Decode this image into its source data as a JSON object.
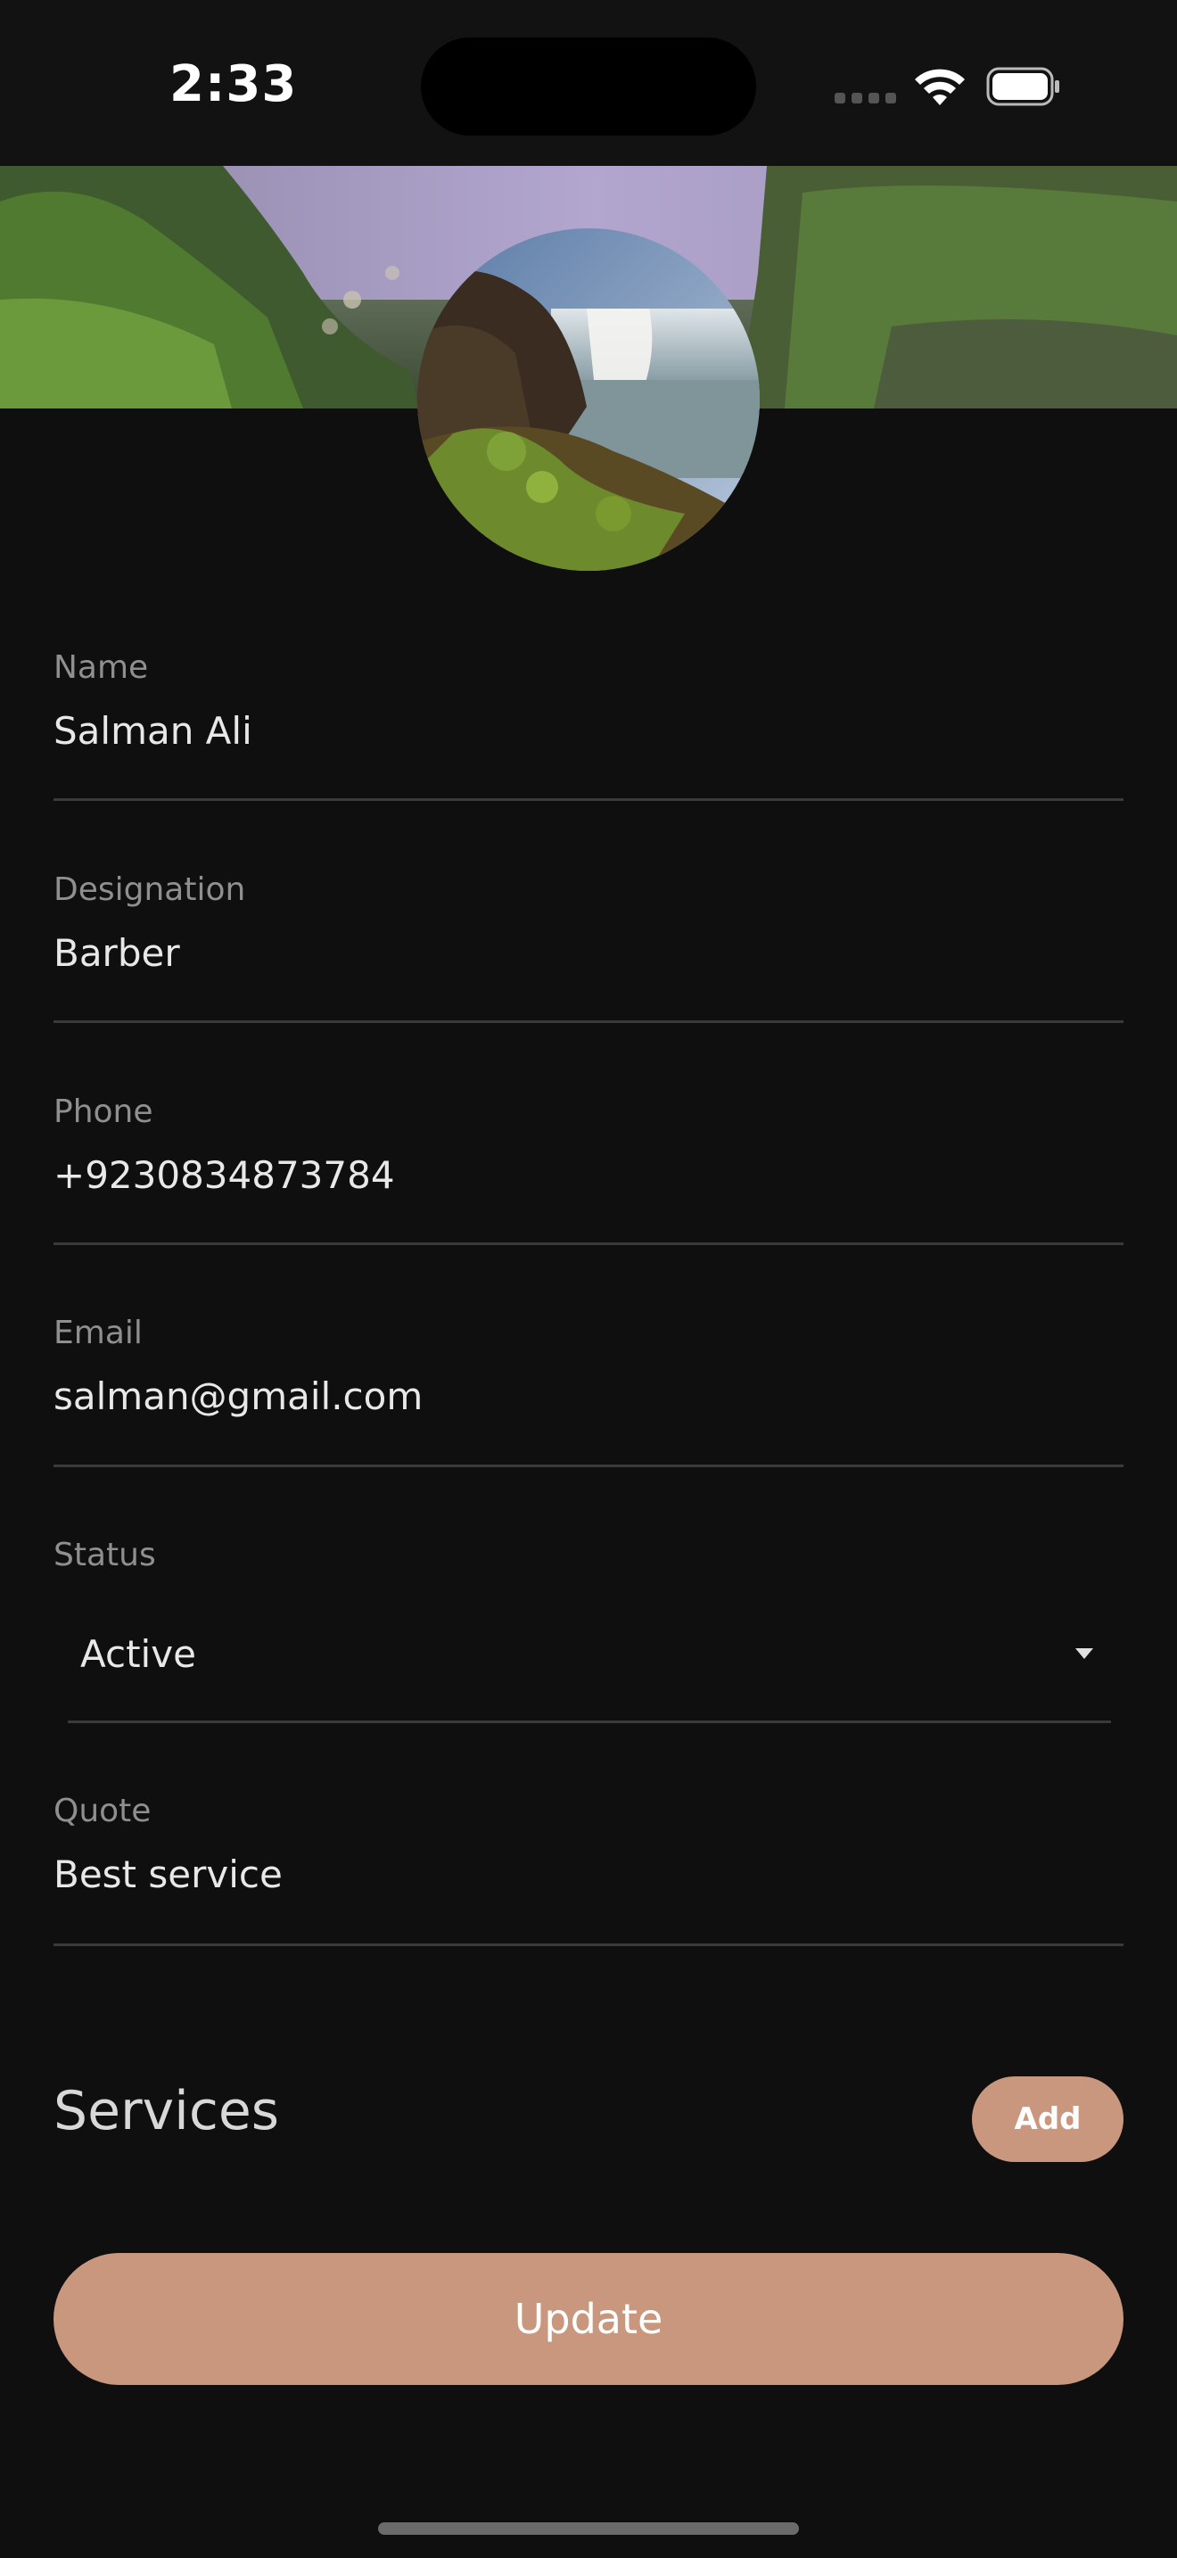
{
  "status_bar": {
    "time": "2:33"
  },
  "profile": {
    "cover_image": "landscape-cover-image",
    "avatar_image": "waterfall-avatar-image"
  },
  "fields": {
    "name": {
      "label": "Name",
      "value": "Salman Ali"
    },
    "designation": {
      "label": "Designation",
      "value": "Barber"
    },
    "phone": {
      "label": "Phone",
      "value": "+9230834873784"
    },
    "email": {
      "label": "Email",
      "value": "salman@gmail.com"
    },
    "status": {
      "label": "Status",
      "value": "Active"
    },
    "quote": {
      "label": "Quote",
      "value": "Best service"
    }
  },
  "services": {
    "title": "Services",
    "add_label": "Add"
  },
  "actions": {
    "update_label": "Update"
  },
  "colors": {
    "background": "#0f0f0f",
    "accent": "#c9977e",
    "label": "#8f8f8f",
    "divider": "#3a3a3a"
  }
}
